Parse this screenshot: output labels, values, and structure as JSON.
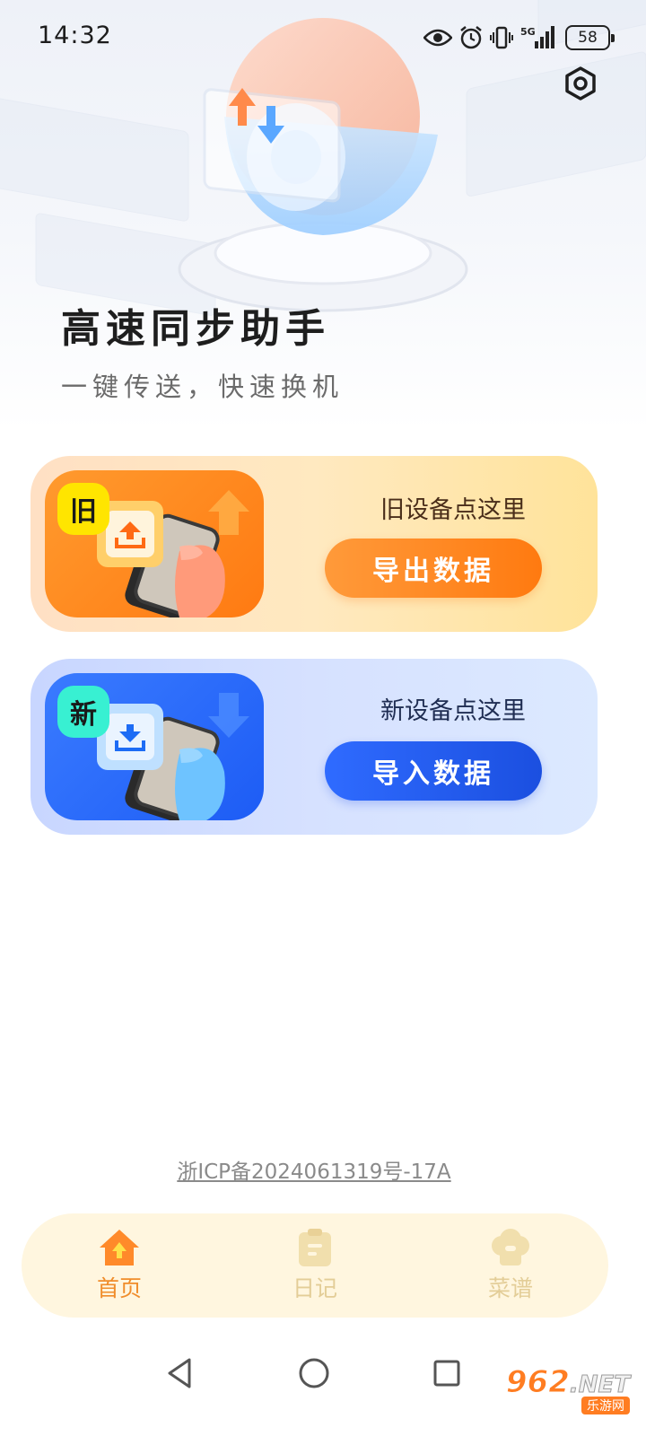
{
  "status": {
    "time": "14:32",
    "network": "5G",
    "battery": "58"
  },
  "hero": {
    "title": "高速同步助手",
    "subtitle": "一键传送，快速换机"
  },
  "cards": [
    {
      "tag": "旧",
      "hint": "旧设备点这里",
      "button": "导出数据",
      "icon": "upload-icon",
      "accent": "#ff7a12"
    },
    {
      "tag": "新",
      "hint": "新设备点这里",
      "button": "导入数据",
      "icon": "download-icon",
      "accent": "#1d5cf5"
    }
  ],
  "icp": "浙ICP备2024061319号-17A",
  "tabs": [
    {
      "label": "首页",
      "icon": "home-icon",
      "active": true
    },
    {
      "label": "日记",
      "icon": "diary-icon",
      "active": false
    },
    {
      "label": "菜谱",
      "icon": "chef-hat-icon",
      "active": false
    }
  ],
  "watermark": {
    "main": "962",
    "suffix": ".NET",
    "sub": "乐游网"
  },
  "colors": {
    "orange": "#f08d2b",
    "blue": "#1d5cf5",
    "tabbar": "#fff6df"
  }
}
